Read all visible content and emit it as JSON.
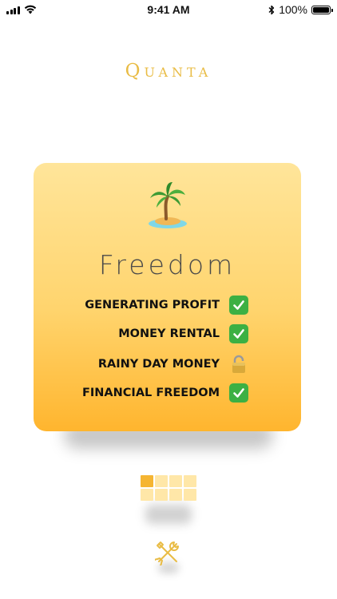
{
  "status_bar": {
    "time": "9:41 AM",
    "battery_percent": "100%",
    "icons": [
      "signal-icon",
      "wifi-icon",
      "bluetooth-icon",
      "battery-icon"
    ]
  },
  "app": {
    "title": "Quanta",
    "accent_color": "#E9BC45"
  },
  "card": {
    "icon": "palm-island-icon",
    "title": "Freedom",
    "items": [
      {
        "label": "GENERATING PROFIT",
        "status": "checked"
      },
      {
        "label": "MONEY RENTAL",
        "status": "checked"
      },
      {
        "label": "RAINY DAY MONEY",
        "status": "locked"
      },
      {
        "label": "FINANCIAL FREEDOM",
        "status": "checked"
      }
    ],
    "gradient_colors": [
      "#FFE59A",
      "#FFB52E"
    ]
  },
  "progress_grid": {
    "total": 8,
    "active": 1,
    "active_color": "#F5B532",
    "inactive_color": "#FFE7A8"
  },
  "footer": {
    "icon": "wrench-screwdriver-icon"
  }
}
